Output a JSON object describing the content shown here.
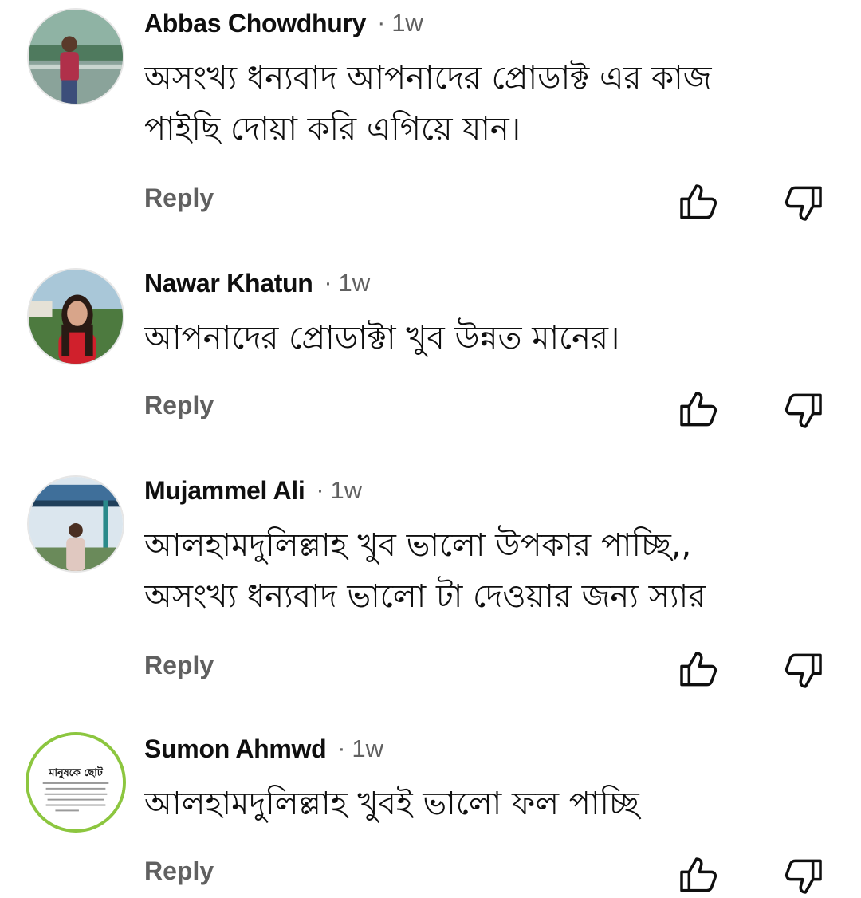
{
  "comments": [
    {
      "author": "Abbas Chowdhury",
      "separator": "·",
      "time": "1w",
      "lines": [
        "অসংখ্য ধন্যবাদ আপনাদের প্রোডাক্ট এর কাজ",
        "পাইছি দোয়া করি এগিয়ে যান।"
      ],
      "reply_label": "Reply",
      "like_icon": "thumbs-up-icon",
      "dislike_icon": "thumbs-down-icon"
    },
    {
      "author": "Nawar Khatun",
      "separator": "·",
      "time": "1w",
      "lines": [
        "আপনাদের প্রোডাক্টা খুব উন্নত মানের।"
      ],
      "reply_label": "Reply",
      "like_icon": "thumbs-up-icon",
      "dislike_icon": "thumbs-down-icon"
    },
    {
      "author": "Mujammel Ali",
      "separator": "·",
      "time": "1w",
      "lines": [
        "আলহামদুলিল্লাহ খুব ভালো উপকার পাচ্ছি,,",
        "অসংখ্য ধন্যবাদ ভালো টা দেওয়ার জন্য স্যার"
      ],
      "reply_label": "Reply",
      "like_icon": "thumbs-up-icon",
      "dislike_icon": "thumbs-down-icon"
    },
    {
      "author": "Sumon Ahmwd",
      "separator": "·",
      "time": "1w",
      "lines": [
        "আলহামদুলিল্লাহ খুবই ভালো ফল পাচ্ছি"
      ],
      "reply_label": "Reply",
      "like_icon": "thumbs-up-icon",
      "dislike_icon": "thumbs-down-icon",
      "avatar_text": "মানুষকে ছোট"
    }
  ],
  "colors": {
    "primary_text": "#0f0f0f",
    "secondary_text": "#606060",
    "background": "#ffffff"
  }
}
